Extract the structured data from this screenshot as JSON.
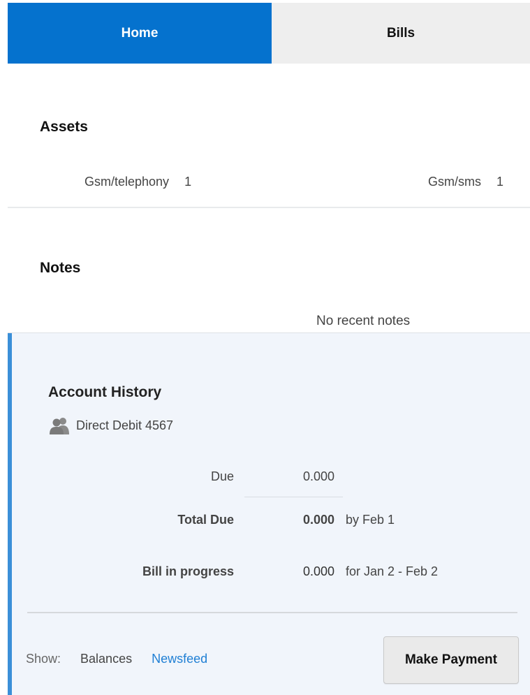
{
  "tabs": [
    {
      "label": "Home"
    },
    {
      "label": "Bills"
    }
  ],
  "assets": {
    "title": "Assets",
    "items": [
      {
        "name": "Gsm/telephony",
        "count": "1"
      },
      {
        "name": "Gsm/sms",
        "count": "1"
      }
    ]
  },
  "notes": {
    "title": "Notes",
    "empty_text": "No recent notes"
  },
  "account": {
    "title": "Account History",
    "payment_method": "Direct Debit 4567",
    "rows": {
      "due": {
        "label": "Due",
        "value": "0.000"
      },
      "total_due": {
        "label": "Total Due",
        "value": "0.000",
        "note": "by Feb 1"
      },
      "bill_in_progress": {
        "label": "Bill in progress",
        "value": "0.000",
        "note": "for Jan 2 - Feb 2"
      }
    },
    "footer": {
      "show_label": "Show:",
      "balances_label": "Balances",
      "newsfeed_label": "Newsfeed"
    },
    "make_payment_label": "Make Payment"
  },
  "colors": {
    "accent": "#0572ce",
    "link": "#1f7fd4",
    "panel_bg": "#f1f5fb"
  }
}
